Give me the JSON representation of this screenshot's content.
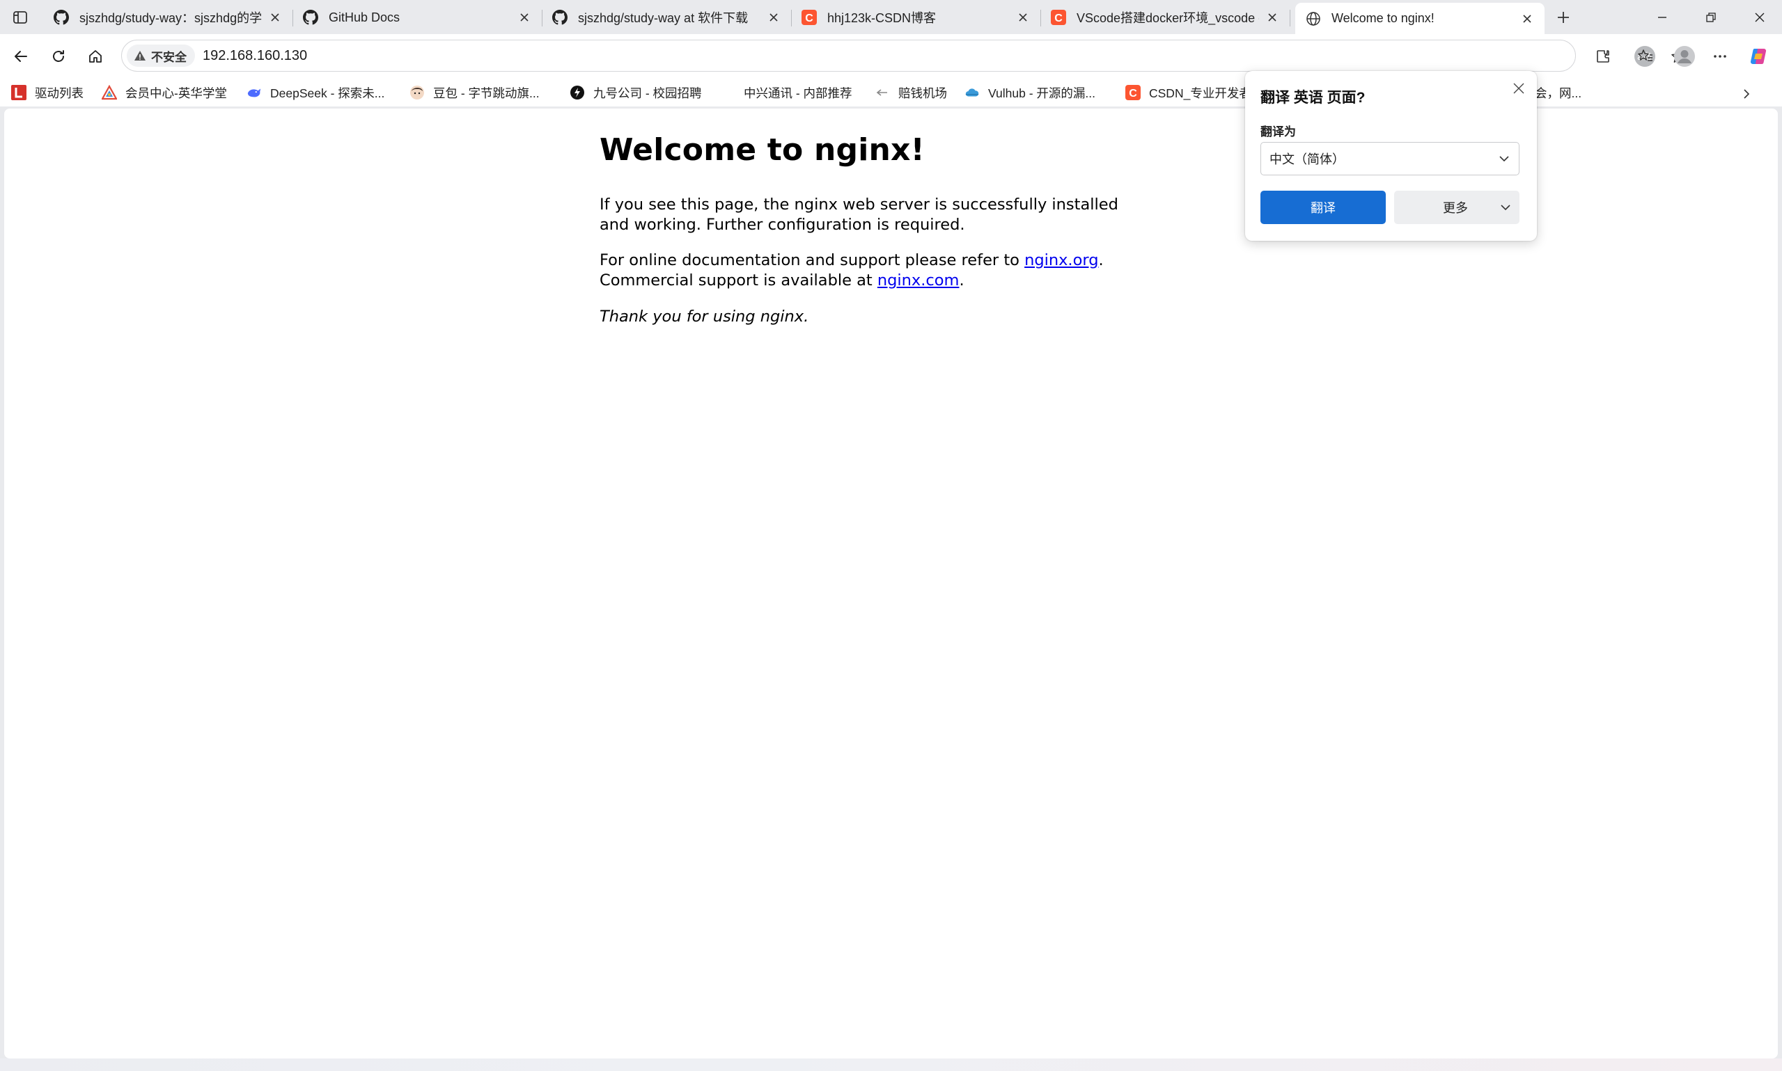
{
  "tabs": [
    {
      "title": "sjszhdg/study-way：sjszhdg的学",
      "favicon": "github-icon",
      "active": false
    },
    {
      "title": "GitHub Docs",
      "favicon": "github-icon",
      "active": false
    },
    {
      "title": "sjszhdg/study-way at 软件下载",
      "favicon": "github-icon",
      "active": false
    },
    {
      "title": "hhj123k-CSDN博客",
      "favicon": "csdn-icon",
      "active": false
    },
    {
      "title": "VScode搭建docker环境_vscode d",
      "favicon": "csdn-icon",
      "active": false
    },
    {
      "title": "Welcome to nginx!",
      "favicon": "globe-icon",
      "active": true
    }
  ],
  "address_bar": {
    "security_label": "不安全",
    "url": "192.168.160.130",
    "translate_indicator": "aあ"
  },
  "bookmarks": [
    {
      "label": "驱动列表",
      "icon": "red-l-icon"
    },
    {
      "label": "会员中心-英华学堂",
      "icon": "triangle-logo-icon"
    },
    {
      "label": "DeepSeek - 探索未...",
      "icon": "whale-icon"
    },
    {
      "label": "豆包 - 字节跳动旗...",
      "icon": "doubao-avatar-icon"
    },
    {
      "label": "九号公司 - 校园招聘",
      "icon": "ninebot-icon"
    },
    {
      "label": "中兴通讯 - 内部推荐",
      "icon": ""
    },
    {
      "label": "赔钱机场",
      "icon": "arrow-left-small-icon"
    },
    {
      "label": "Vulhub - 开源的漏...",
      "icon": "cloud-icon"
    },
    {
      "label": "CSDN_专业开发者",
      "icon": "csdn-icon"
    },
    {
      "label": "会，网...",
      "icon": ""
    }
  ],
  "page": {
    "title": "Welcome to nginx!",
    "para1": "If you see this page, the nginx web server is successfully installed and working. Further configuration is required.",
    "para2_before": "For online documentation and support please refer to ",
    "link1": "nginx.org",
    "para2_mid": ".",
    "para2_line2": "Commercial support is available at ",
    "link2": "nginx.com",
    "para2_end": ".",
    "para3": "Thank you for using nginx."
  },
  "translate_popup": {
    "title": "翻译 英语 页面?",
    "label": "翻译为",
    "selected_language": "中文（简体）",
    "translate_button": "翻译",
    "more_button": "更多"
  },
  "colors": {
    "link": "#0000ee",
    "primary_button": "#176dd3",
    "chrome_bg": "#e9eaed"
  }
}
